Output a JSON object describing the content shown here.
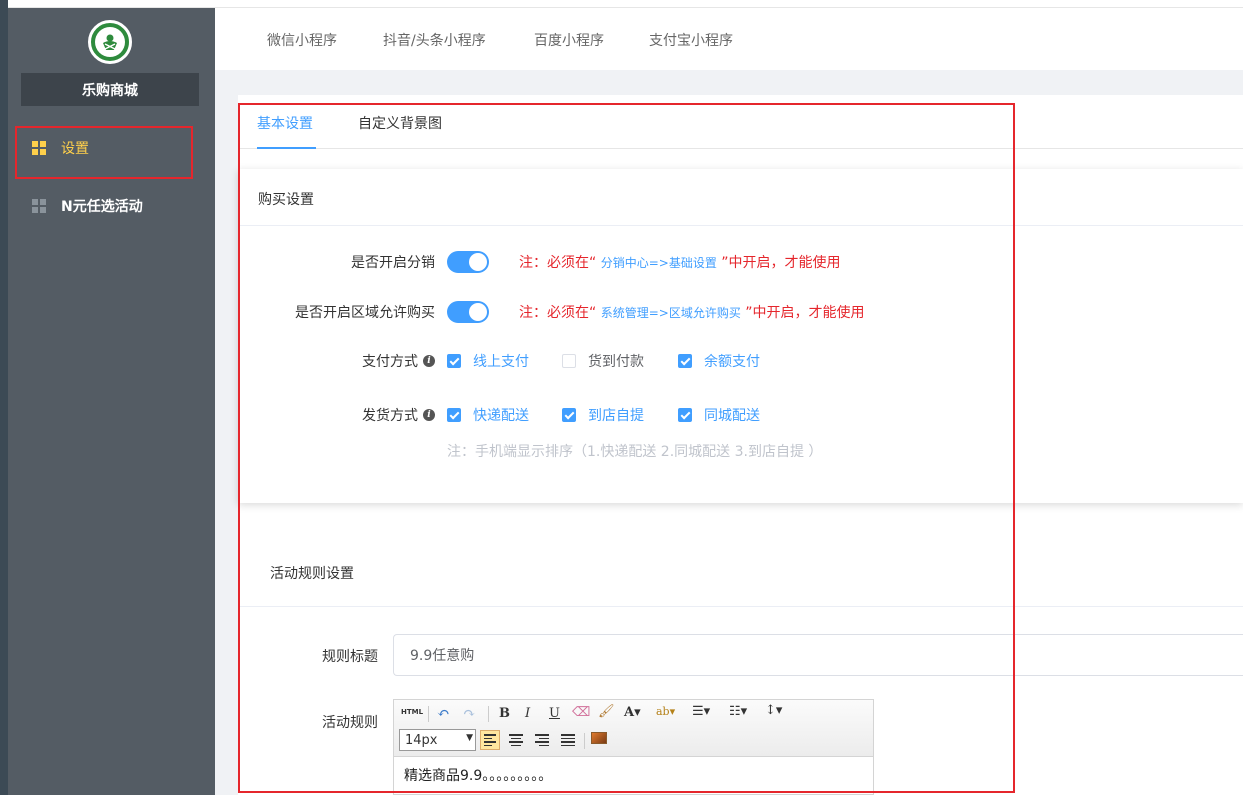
{
  "sidebar": {
    "brand": "乐购商城",
    "items": [
      {
        "label": "设置",
        "icon": "grid-icon"
      },
      {
        "label": "N元任选活动",
        "icon": "grid-icon"
      }
    ]
  },
  "top_tabs": [
    "微信小程序",
    "抖音/头条小程序",
    "百度小程序",
    "支付宝小程序"
  ],
  "sub_tabs": [
    "基本设置",
    "自定义背景图"
  ],
  "buy_section": {
    "title": "购买设置",
    "distribution": {
      "label": "是否开启分销",
      "enabled": true,
      "note_prefix": "注：必须在“",
      "note_link": "分销中心=>基础设置",
      "note_suffix": "”中开启，才能使用"
    },
    "region": {
      "label": "是否开启区域允许购买",
      "enabled": true,
      "note_prefix": "注：必须在“",
      "note_link": "系统管理=>区域允许购买",
      "note_suffix": "”中开启，才能使用"
    },
    "payment": {
      "label": "支付方式",
      "options": [
        {
          "label": "线上支付",
          "checked": true
        },
        {
          "label": "货到付款",
          "checked": false
        },
        {
          "label": "余额支付",
          "checked": true
        }
      ]
    },
    "delivery": {
      "label": "发货方式",
      "options": [
        {
          "label": "快递配送",
          "checked": true
        },
        {
          "label": "到店自提",
          "checked": true
        },
        {
          "label": "同城配送",
          "checked": true
        }
      ],
      "hint": "注：手机端显示排序（1.快递配送 2.同城配送 3.到店自提 ）"
    }
  },
  "rules_section": {
    "title": "活动规则设置",
    "rule_title_label": "规则标题",
    "rule_title_value": "9.9任意购",
    "rule_content_label": "活动规则",
    "editor": {
      "font_size": "14px",
      "content": "精选商品9.9。。。。。。。。。"
    }
  },
  "colors": {
    "sidebar_bg": "#545c64",
    "active_menu": "#ffd04b",
    "primary": "#409eff",
    "highlight_frame": "#e5262c"
  }
}
